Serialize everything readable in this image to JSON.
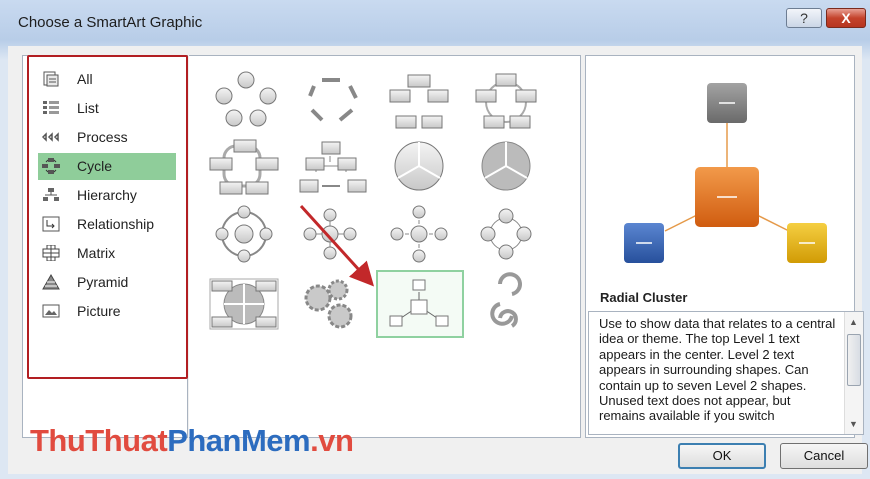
{
  "dialog": {
    "title": "Choose a SmartArt Graphic",
    "help_label": "?",
    "close_label": "X"
  },
  "categories": [
    {
      "label": "All",
      "icon": "all-icon"
    },
    {
      "label": "List",
      "icon": "list-icon"
    },
    {
      "label": "Process",
      "icon": "process-icon"
    },
    {
      "label": "Cycle",
      "icon": "cycle-icon",
      "selected": true
    },
    {
      "label": "Hierarchy",
      "icon": "hierarchy-icon"
    },
    {
      "label": "Relationship",
      "icon": "relationship-icon"
    },
    {
      "label": "Matrix",
      "icon": "matrix-icon"
    },
    {
      "label": "Pyramid",
      "icon": "pyramid-icon"
    },
    {
      "label": "Picture",
      "icon": "picture-icon"
    }
  ],
  "gallery": {
    "layouts": [
      "basic-cycle",
      "text-cycle",
      "block-cycle",
      "nondirectional-cycle",
      "continuous-cycle",
      "segmented-cycle",
      "circular-pie",
      "basic-pie",
      "radial-cycle",
      "basic-radial",
      "diverging-radial",
      "radial-venn",
      "cycle-matrix",
      "gear",
      "radial-cluster",
      "circle-arrow-process"
    ],
    "selected": "radial-cluster"
  },
  "preview": {
    "title": "Radial Cluster",
    "description": "Use to show data that relates to a central idea or theme. The top Level 1 text appears in the center. Level 2 text appears in surrounding shapes. Can contain up to seven Level 2 shapes. Unused text does not appear, but remains available if you switch",
    "colors": {
      "center": "#e1711c",
      "top": "#7a7a7a",
      "left": "#2f5fb5",
      "right": "#e8b20c",
      "connector": "#e59a4a"
    }
  },
  "buttons": {
    "ok_label": "OK",
    "cancel_label": "Cancel"
  },
  "watermark": {
    "part1": "ThuThuat",
    "part2": "PhanMem",
    "part3": ".vn"
  },
  "annotation": {
    "color": "#c2282a",
    "frame_color": "#b21e22"
  }
}
